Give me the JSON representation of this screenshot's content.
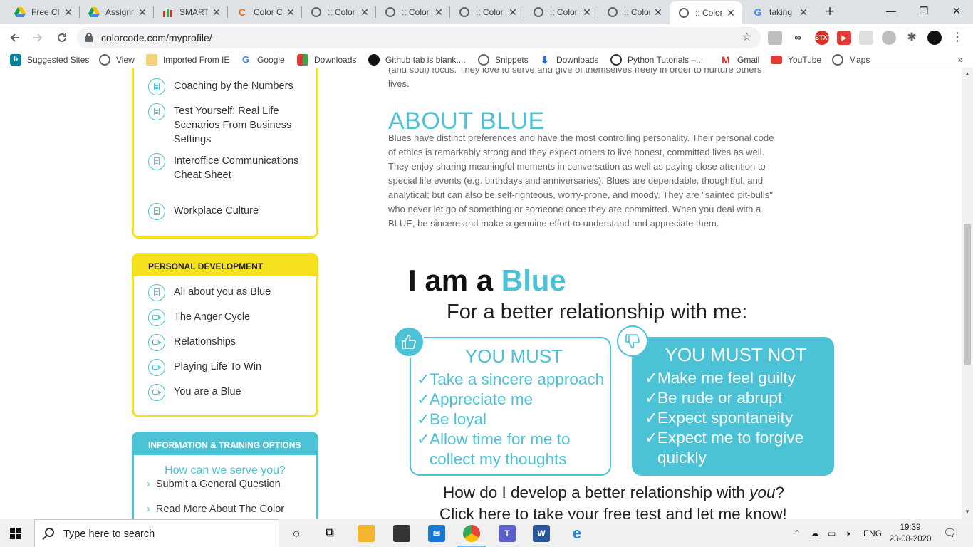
{
  "tabs": [
    {
      "title": "Free Cl",
      "icon": "google-drive-icon"
    },
    {
      "title": "Assignr",
      "icon": "google-drive-icon"
    },
    {
      "title": "SMART",
      "icon": "smart-icon"
    },
    {
      "title": "Color C",
      "icon": "colorcode-icon"
    },
    {
      "title": ":: Color",
      "icon": "globe-icon"
    },
    {
      "title": ":: Color",
      "icon": "globe-icon"
    },
    {
      "title": ":: Color",
      "icon": "globe-icon"
    },
    {
      "title": ":: Color",
      "icon": "globe-icon"
    },
    {
      "title": ":: Color",
      "icon": "globe-icon"
    },
    {
      "title": ":: Color",
      "icon": "globe-icon"
    },
    {
      "title": "taking s",
      "icon": "google-icon"
    }
  ],
  "tab_close": "✕",
  "new_tab": "+",
  "window": {
    "minimize": "—",
    "restore": "❐",
    "close": "✕"
  },
  "address": {
    "url": "colorcode.com/myprofile/"
  },
  "extensions": {
    "stxt": "STXT"
  },
  "bookmarks": [
    "Suggested Sites",
    "View",
    "Imported From IE",
    "Google",
    "Downloads",
    "Github tab is blank....",
    "Snippets",
    "Downloads",
    "Python Tutorials –...",
    "Gmail",
    "YouTube",
    "Maps"
  ],
  "bookmarks_more": "»",
  "sidebar": {
    "box1_items": [
      "Coaching by the Numbers",
      "Test Yourself: Real Life Scenarios From Business Settings",
      "Interoffice Communications Cheat Sheet",
      "Workplace Culture"
    ],
    "personal_title": "PERSONAL DEVELOPMENT",
    "personal_items": [
      "All about you as Blue",
      "The Anger Cycle",
      "Relationships",
      "Playing Life To Win",
      "You are a Blue"
    ],
    "info_title": "INFORMATION & TRAINING OPTIONS",
    "serve": "How can we serve you?",
    "links": [
      "Submit a General Question",
      "Read More About The Color"
    ]
  },
  "main": {
    "intro": "(and soul) focus. They love to serve and give of themselves freely in order to nurture others' lives.",
    "about_heading": "ABOUT BLUE",
    "about_body": "Blues have distinct preferences and have the most controlling personality. Their personal code of ethics is remarkably strong and they expect others to live honest, committed lives as well. They enjoy sharing meaningful moments in conversation as well as paying close attention to special life events (e.g. birthdays and anniversaries). Blues are dependable, thoughtful, and analytical; but can also be self-righteous, worry-prone, and moody. They are \"sainted pit-bulls\" who never let go of something or someone once they are committed. When you deal with a BLUE, be sincere and make a genuine effort to understand and appreciate them."
  },
  "infographic": {
    "iam": "I am a",
    "color": "Blue",
    "subtitle": "For a better relationship with me:",
    "check": "✓",
    "must_title": "YOU MUST",
    "must_items": [
      "Take a sincere approach",
      "Appreciate me",
      "Be loyal",
      "Allow time for me to"
    ],
    "must_cont": "collect my thoughts",
    "mustnot_title": "YOU MUST NOT",
    "mustnot_items": [
      "Make me feel guilty",
      "Be rude or abrupt",
      "Expect spontaneity",
      "Expect me to forgive"
    ],
    "mustnot_cont": "quickly",
    "develop_pre": "How do I develop a better relationship with",
    "develop_you": "you",
    "develop_q": "?",
    "click_here": "Click here to take your free test and let me know!"
  },
  "taskbar": {
    "search_placeholder": "Type here to search",
    "lang": "ENG",
    "time": "19:39",
    "date": "23-08-2020"
  },
  "colors": {
    "accent_blue": "#4cc2d6",
    "accent_yellow": "#f5e11d"
  }
}
